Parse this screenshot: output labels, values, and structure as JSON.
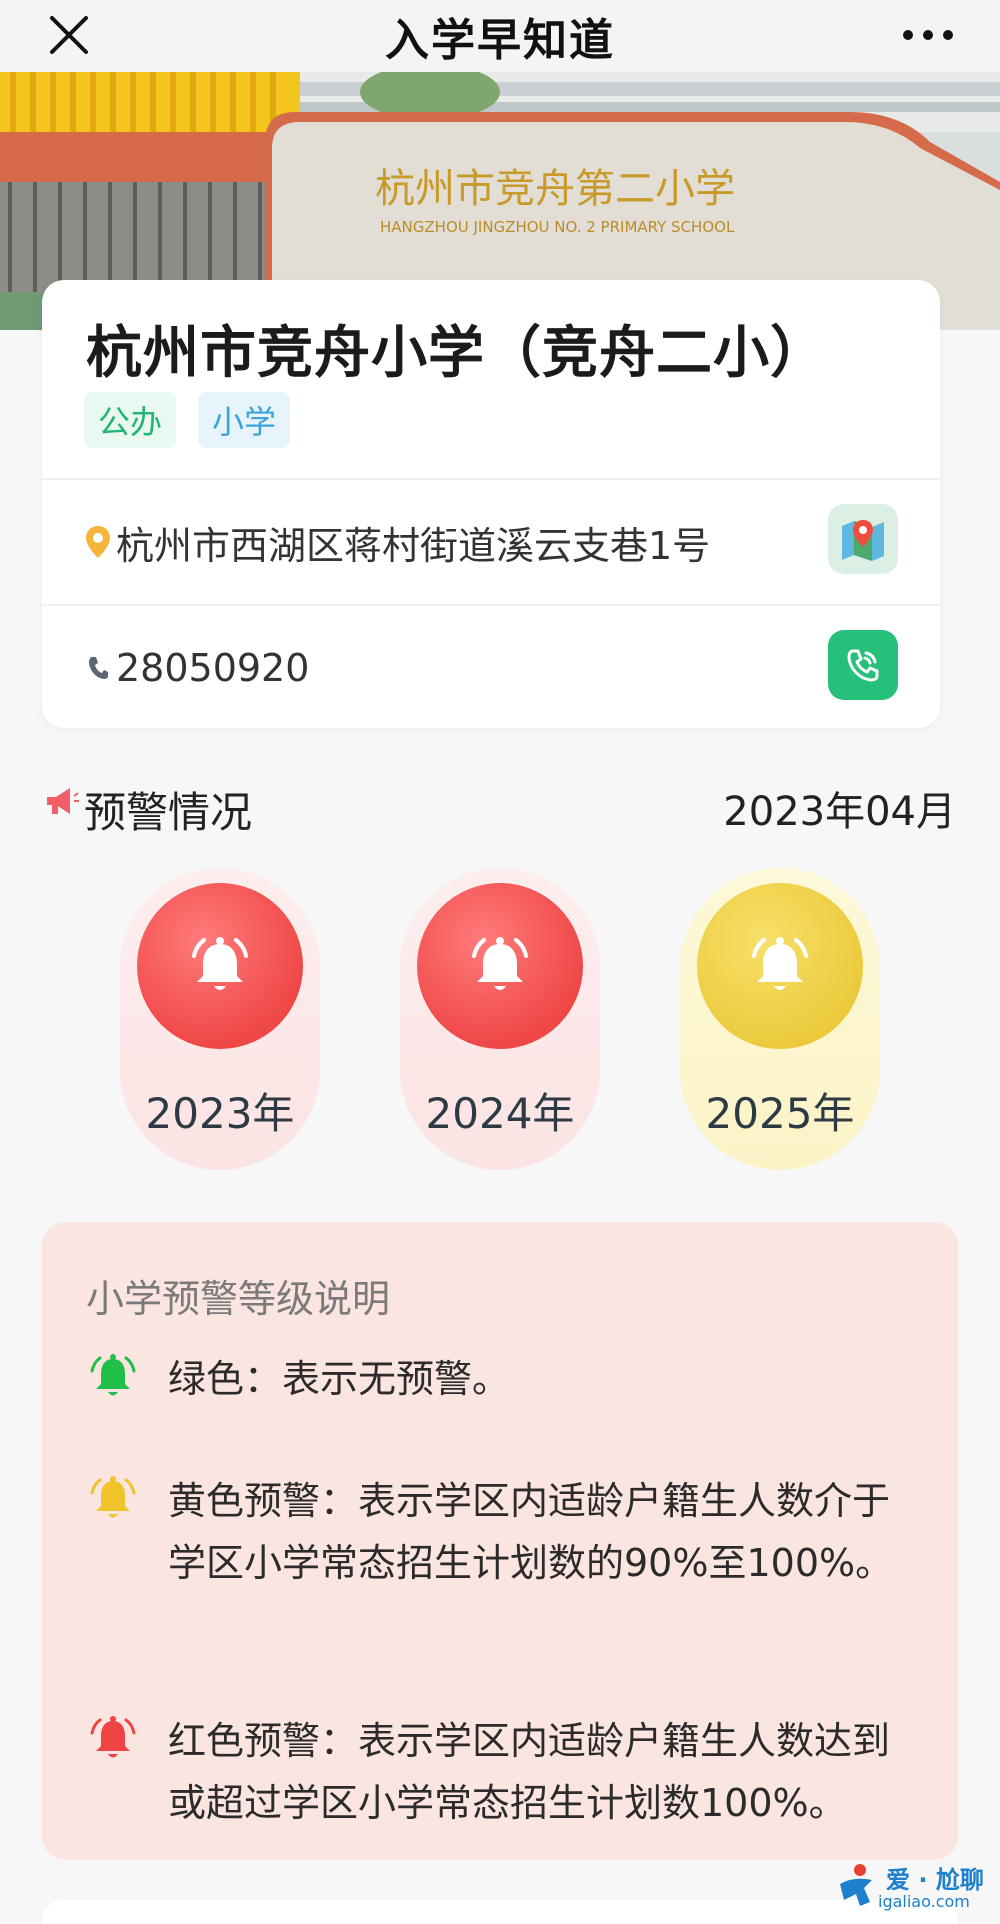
{
  "header": {
    "title": "入学早知道"
  },
  "school": {
    "name": "杭州市竞舟小学（竞舟二小）",
    "banner_sign_cn": "杭州市竞舟第二小学",
    "banner_sign_en": "HANGZHOU JINGZHOU NO. 2 PRIMARY SCHOOL",
    "tags": [
      "公办",
      "小学"
    ],
    "address": "杭州市西湖区蒋村街道溪云支巷1号",
    "phone": "28050920"
  },
  "warning": {
    "label": "预警情况",
    "date": "2023年04月",
    "years": [
      {
        "year": "2023年",
        "level": "red"
      },
      {
        "year": "2024年",
        "level": "red"
      },
      {
        "year": "2025年",
        "level": "yellow"
      }
    ]
  },
  "explanation": {
    "heading": "小学预警等级说明",
    "items": [
      {
        "level": "green",
        "text": "绿色：表示无预警。"
      },
      {
        "level": "yellow",
        "text": "黄色预警：表示学区内适龄户籍生人数介于学区小学常态招生计划数的90%至100%。"
      },
      {
        "level": "red",
        "text": "红色预警：表示学区内适龄户籍生人数达到或超过学区小学常态招生计划数100%。"
      }
    ]
  },
  "watermark": {
    "title": "爱 · 尬聊",
    "url": "igaliao.com"
  },
  "colors": {
    "green": "#1fbf4a",
    "yellow": "#f2c42c",
    "red": "#ee4444",
    "accent_green": "#27c07a"
  }
}
